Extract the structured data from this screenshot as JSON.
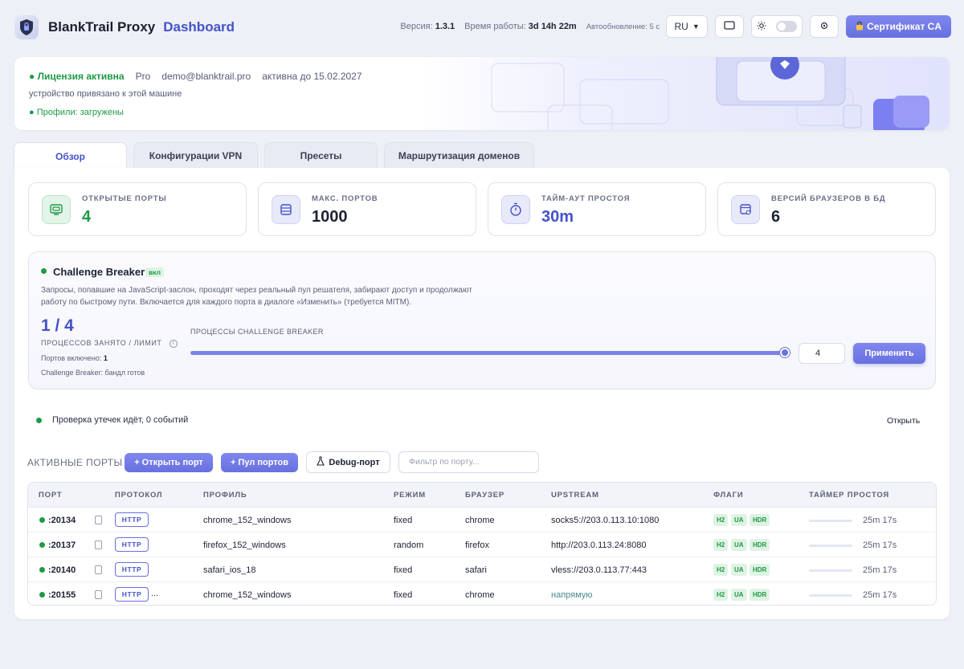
{
  "header": {
    "app_name": "BlankTrail Proxy",
    "section": "Dashboard",
    "version_label": "Версия:",
    "version": "1.3.1",
    "uptime_label": "Время работы:",
    "uptime": "3d 14h 22m",
    "autorefresh": "Автообновление: 5 с",
    "language": "RU",
    "cert_button": "Сертификат CA",
    "icons": [
      "shield-lock-icon",
      "monitor-icon",
      "sun-icon",
      "gear-icon",
      "lock-icon"
    ]
  },
  "license": {
    "status": "● Лицензия активна",
    "plan": "Pro",
    "email": "demo@blanktrail.pro",
    "expires": "активна до 15.02.2027",
    "device_note": "устройство привязано к этой машине",
    "profiles": "● Профили: загружены"
  },
  "tabs": [
    {
      "label": "Обзор",
      "active": true
    },
    {
      "label": "Конфигурации VPN",
      "active": false
    },
    {
      "label": "Пресеты",
      "active": false
    },
    {
      "label": "Маршрутизация доменов",
      "active": false
    }
  ],
  "stats": [
    {
      "label": "ОТКРЫТЫЕ ПОРТЫ",
      "value": "4",
      "color": "#1f9a45",
      "icon": "ports-icon"
    },
    {
      "label": "МАКС. ПОРТОВ",
      "value": "1000",
      "color": "#1d2233",
      "icon": "server-icon"
    },
    {
      "label": "ТАЙМ-АУТ ПРОСТОЯ",
      "value": "30m",
      "color": "#4552c8",
      "icon": "stopwatch-icon"
    },
    {
      "label": "ВЕРСИЙ БРАУЗЕРОВ В БД",
      "value": "6",
      "color": "#1d2233",
      "icon": "browser-icon"
    }
  ],
  "challenge_breaker": {
    "title": "Challenge Breaker",
    "badge": "вкл",
    "description": "Запросы, попавшие на JavaScript-заслон, проходят через реальный пул решателя, забирают доступ и продолжают работу по быстрому пути. Включается для каждого порта в диалоге «Изменить» (требуется MITM).",
    "count": "1 / 4",
    "count_label": "ПРОЦЕССОВ ЗАНЯТО / ЛИМИТ",
    "ports_label": "Портов включено:",
    "ports_value": "1",
    "status": "Challenge Breaker: бандл готов",
    "slider_label": "ПРОЦЕССЫ CHALLENGE BREAKER",
    "slider_value": 4,
    "input_value": "4",
    "apply_button": "Применить"
  },
  "leak": {
    "text": "Проверка утечек идёт, 0 событий",
    "open": "Открыть"
  },
  "ports": {
    "title": "АКТИВНЫЕ ПОРТЫ",
    "open_port": "+ Открыть порт",
    "port_pool": "+ Пул портов",
    "debug_port": "Debug-порт",
    "filter_placeholder": "Фильтр по порту...",
    "columns": [
      "ПОРТ",
      "ПРОТОКОЛ",
      "ПРОФИЛЬ",
      "РЕЖИМ",
      "БРАУЗЕР",
      "UPSTREAM",
      "ФЛАГИ",
      "ТАЙМЕР ПРОСТОЯ"
    ],
    "rows": [
      {
        "port": ":20134",
        "protocol": "HTTP",
        "protocol_more": "",
        "profile": "chrome_152_windows",
        "mode": "fixed",
        "browser": "chrome",
        "upstream": "socks5://203.0.113.10:1080",
        "flags": [
          "H2",
          "UA",
          "HDR"
        ],
        "timer": "25m 17s",
        "timer_fraction": 0.85
      },
      {
        "port": ":20137",
        "protocol": "HTTP",
        "protocol_more": "",
        "profile": "firefox_152_windows",
        "mode": "random",
        "browser": "firefox",
        "upstream": "http://203.0.113.24:8080",
        "flags": [
          "H2",
          "UA",
          "HDR"
        ],
        "timer": "25m 17s",
        "timer_fraction": 0.85
      },
      {
        "port": ":20140",
        "protocol": "HTTP",
        "protocol_more": "",
        "profile": "safari_ios_18",
        "mode": "fixed",
        "browser": "safari",
        "upstream": "vless://203.0.113.77:443",
        "flags": [
          "H2",
          "UA",
          "HDR"
        ],
        "timer": "25m 17s",
        "timer_fraction": 0.85
      },
      {
        "port": ":20155",
        "protocol": "HTTP",
        "protocol_more": "...",
        "profile": "chrome_152_windows",
        "mode": "fixed",
        "browser": "chrome",
        "upstream": "напрямую",
        "flags": [
          "H2",
          "UA",
          "HDR"
        ],
        "timer": "25m 17s",
        "timer_fraction": 0.85
      }
    ]
  }
}
